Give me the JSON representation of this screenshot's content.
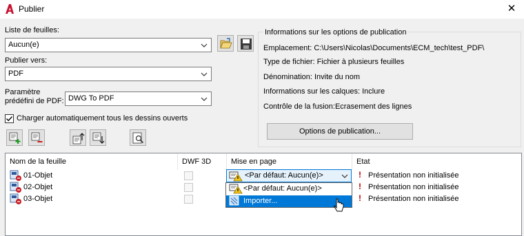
{
  "window": {
    "title": "Publier",
    "close_glyph": "✕"
  },
  "left": {
    "sheet_list_label": "Liste de feuilles:",
    "sheet_list_value": "Aucun(e)",
    "publish_to_label": "Publier vers:",
    "publish_to_value": "PDF",
    "preset_label_line1": "Paramètre",
    "preset_label_line2": "prédéfini de PDF:",
    "preset_value": "DWG To PDF",
    "auto_load_label": "Charger automatiquement tous les dessins ouverts",
    "auto_load_checked": true
  },
  "info": {
    "group_title": "Informations sur les options de publication",
    "location_label": "Emplacement:",
    "location_value": "C:\\Users\\Nicolas\\Documents\\ECM_tech\\test_PDF\\",
    "file_type_label": "Type de fichier:",
    "file_type_value": "Fichier à plusieurs feuilles",
    "naming_label": "Dénomination:",
    "naming_value": "Invite du nom",
    "layers_label": "Informations sur les calques:",
    "layers_value": "Inclure",
    "merge_label": "Contrôle de la fusion:",
    "merge_value": "Ecrasement des lignes",
    "options_button": "Options de publication..."
  },
  "list": {
    "columns": [
      "Nom de la feuille",
      "DWF 3D",
      "Mise en page",
      "Etat"
    ],
    "rows": [
      {
        "name": "01-Objet",
        "state": "Présentation non initialisée"
      },
      {
        "name": "02-Objet",
        "state": "Présentation non initialisée"
      },
      {
        "name": "03-Objet",
        "state": "Présentation non initialisée"
      }
    ],
    "page_setup_value": "<Par défaut: Aucun(e)>",
    "dropdown_items": [
      "<Par défaut: Aucun(e)>",
      "Importer..."
    ],
    "state_icon": "!"
  },
  "colors": {
    "accent": "#0078d7",
    "error": "#c00000",
    "logo": "#c8102e"
  }
}
